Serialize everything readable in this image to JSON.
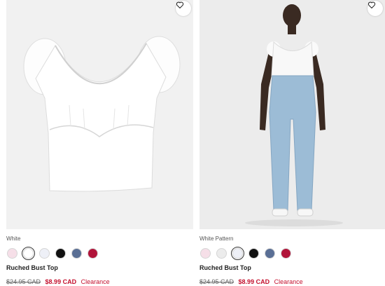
{
  "products": [
    {
      "color_name": "White",
      "name": "Ruched Bust Top",
      "original_price": "$24.95 CAD",
      "sale_price": "$8.99 CAD",
      "tag": "Clearance",
      "swatches": [
        "#f6dfe8",
        "#ffffff",
        "#eef0f7",
        "#111111",
        "#5a6f95",
        "#b1143a"
      ],
      "selected_swatch": 1,
      "image": "white puff-sleeve top product photo"
    },
    {
      "color_name": "White Pattern",
      "name": "Ruched Bust Top",
      "original_price": "$24.95 CAD",
      "sale_price": "$8.99 CAD",
      "tag": "Clearance",
      "swatches": [
        "#f6dfe8",
        "#ececec",
        "#eef0f7",
        "#111111",
        "#5a6f95",
        "#b1143a"
      ],
      "selected_swatch": 2,
      "image": "model wearing white top and light-wash jeans"
    }
  ],
  "icons": {
    "wishlist": "heart-icon"
  }
}
